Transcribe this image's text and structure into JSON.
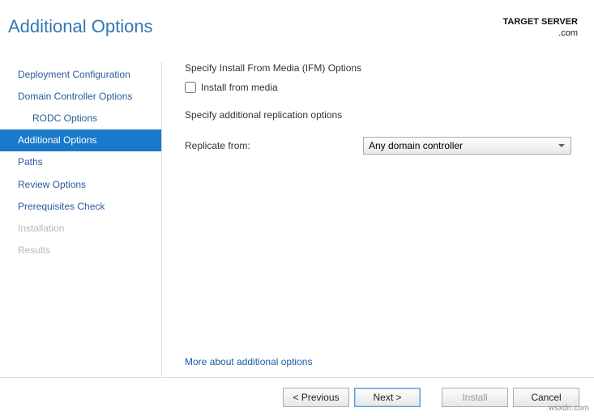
{
  "header": {
    "title": "Additional Options",
    "target_label": "TARGET SERVER",
    "target_server": ".com"
  },
  "sidebar": {
    "items": [
      {
        "label": "Deployment Configuration",
        "indent": false,
        "active": false,
        "disabled": false
      },
      {
        "label": "Domain Controller Options",
        "indent": false,
        "active": false,
        "disabled": false
      },
      {
        "label": "RODC Options",
        "indent": true,
        "active": false,
        "disabled": false
      },
      {
        "label": "Additional Options",
        "indent": false,
        "active": true,
        "disabled": false
      },
      {
        "label": "Paths",
        "indent": false,
        "active": false,
        "disabled": false
      },
      {
        "label": "Review Options",
        "indent": false,
        "active": false,
        "disabled": false
      },
      {
        "label": "Prerequisites Check",
        "indent": false,
        "active": false,
        "disabled": false
      },
      {
        "label": "Installation",
        "indent": false,
        "active": false,
        "disabled": true
      },
      {
        "label": "Results",
        "indent": false,
        "active": false,
        "disabled": true
      }
    ]
  },
  "content": {
    "ifm_heading": "Specify Install From Media (IFM) Options",
    "ifm_checkbox_label": "Install from media",
    "ifm_checked": false,
    "replication_heading": "Specify additional replication options",
    "replicate_label": "Replicate from:",
    "replicate_selected": "Any domain controller",
    "more_link": "More about additional options"
  },
  "footer": {
    "previous": "< Previous",
    "next": "Next >",
    "install": "Install",
    "cancel": "Cancel"
  },
  "watermark": "wsxdn.com"
}
